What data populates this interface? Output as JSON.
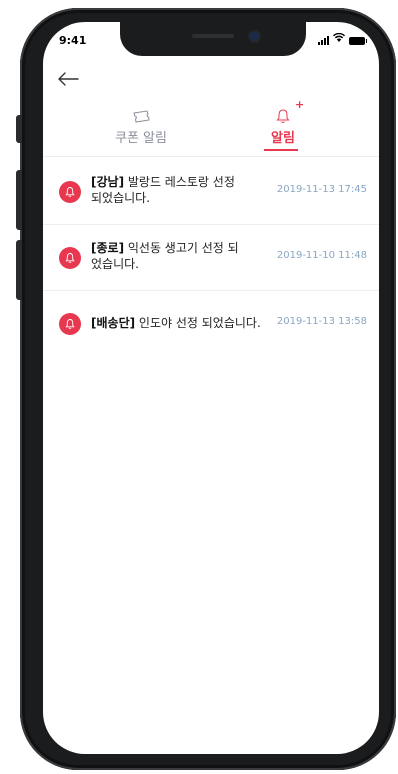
{
  "status_bar": {
    "time": "9:41"
  },
  "tabs": [
    {
      "label": "쿠폰 알림",
      "icon": "ticket-icon",
      "active": false
    },
    {
      "label": "알림",
      "icon": "bell-outline-icon",
      "active": true,
      "badge": "+"
    }
  ],
  "notifications": [
    {
      "tag": "[강남]",
      "text": " 발랑드 레스토랑 선정 되었습니다.",
      "date": "2019-11-13 17:45"
    },
    {
      "tag": "[종로]",
      "text": " 익선동 생고기 선정 되었습니다.",
      "date": "2019-11-10 11:48"
    },
    {
      "tag": "[배송단]",
      "text": " 인도야 선정 되었습니다.",
      "date": "2019-11-13 13:58"
    }
  ],
  "colors": {
    "accent": "#e8384f",
    "date": "#8aa6c4",
    "inactive_tab": "#8b8f9a"
  }
}
